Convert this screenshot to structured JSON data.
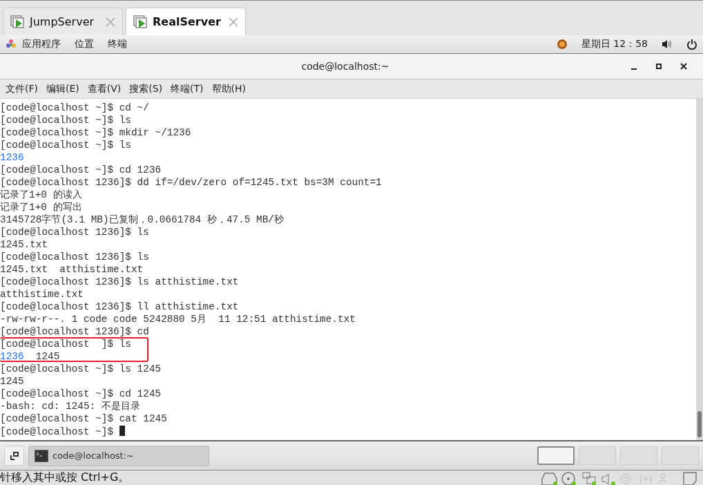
{
  "tabs": [
    {
      "label": "JumpServer",
      "selected": false
    },
    {
      "label": "RealServer",
      "selected": true
    }
  ],
  "top_panel": {
    "menus": [
      "应用程序",
      "位置",
      "终端"
    ],
    "clock": "星期日 12：58"
  },
  "window": {
    "title": "code@localhost:~"
  },
  "menu_bar": [
    "文件(F)",
    "编辑(E)",
    "查看(V)",
    "搜索(S)",
    "终端(T)",
    "帮助(H)"
  ],
  "terminal": {
    "lines": [
      {
        "parts": [
          {
            "text": "[code@localhost ~]$ cd ~/",
            "kind": "plain"
          }
        ],
        "highlighted": false,
        "cursor": false
      },
      {
        "parts": [
          {
            "text": "[code@localhost ~]$ ls",
            "kind": "plain"
          }
        ],
        "highlighted": false,
        "cursor": false
      },
      {
        "parts": [
          {
            "text": "[code@localhost ~]$ mkdir ~/1236",
            "kind": "plain"
          }
        ],
        "highlighted": false,
        "cursor": false
      },
      {
        "parts": [
          {
            "text": "[code@localhost ~]$ ls",
            "kind": "plain"
          }
        ],
        "highlighted": false,
        "cursor": false
      },
      {
        "parts": [
          {
            "text": "1236",
            "kind": "dir"
          }
        ],
        "highlighted": false,
        "cursor": false
      },
      {
        "parts": [
          {
            "text": "[code@localhost ~]$ cd 1236",
            "kind": "plain"
          }
        ],
        "highlighted": false,
        "cursor": false
      },
      {
        "parts": [
          {
            "text": "[code@localhost 1236]$ dd if=/dev/zero of=1245.txt bs=3M count=1",
            "kind": "plain"
          }
        ],
        "highlighted": false,
        "cursor": false
      },
      {
        "parts": [
          {
            "text": "记录了1+0 的读入",
            "kind": "plain"
          }
        ],
        "highlighted": false,
        "cursor": false
      },
      {
        "parts": [
          {
            "text": "记录了1+0 的写出",
            "kind": "plain"
          }
        ],
        "highlighted": false,
        "cursor": false
      },
      {
        "parts": [
          {
            "text": "3145728字节(3.1 MB)已复制，0.0661784 秒，47.5 MB/秒",
            "kind": "plain"
          }
        ],
        "highlighted": false,
        "cursor": false
      },
      {
        "parts": [
          {
            "text": "[code@localhost 1236]$ ls",
            "kind": "plain"
          }
        ],
        "highlighted": false,
        "cursor": false
      },
      {
        "parts": [
          {
            "text": "1245.txt",
            "kind": "plain"
          }
        ],
        "highlighted": false,
        "cursor": false
      },
      {
        "parts": [
          {
            "text": "[code@localhost 1236]$ ls",
            "kind": "plain"
          }
        ],
        "highlighted": false,
        "cursor": false
      },
      {
        "parts": [
          {
            "text": "1245.txt  atthistime.txt",
            "kind": "plain"
          }
        ],
        "highlighted": false,
        "cursor": false
      },
      {
        "parts": [
          {
            "text": "[code@localhost 1236]$ ls atthistime.txt",
            "kind": "plain"
          }
        ],
        "highlighted": false,
        "cursor": false
      },
      {
        "parts": [
          {
            "text": "atthistime.txt",
            "kind": "plain"
          }
        ],
        "highlighted": false,
        "cursor": false
      },
      {
        "parts": [
          {
            "text": "[code@localhost 1236]$ ll atthistime.txt",
            "kind": "plain"
          }
        ],
        "highlighted": false,
        "cursor": false
      },
      {
        "parts": [
          {
            "text": "-rw-rw-r--. 1 code code 5242880 5月  11 12:51 atthistime.txt",
            "kind": "plain"
          }
        ],
        "highlighted": false,
        "cursor": false
      },
      {
        "parts": [
          {
            "text": "[code@localhost 1236]$ cd",
            "kind": "plain"
          }
        ],
        "highlighted": false,
        "cursor": false
      },
      {
        "parts": [
          {
            "text": "[code@localhost  ]$ ls",
            "kind": "plain"
          }
        ],
        "highlighted": true,
        "cursor": false
      },
      {
        "parts": [
          {
            "text": "1236",
            "kind": "dir"
          },
          {
            "text": "  1245",
            "kind": "plain"
          }
        ],
        "highlighted": true,
        "cursor": false
      },
      {
        "parts": [
          {
            "text": "[code@localhost ~]$ ls 1245",
            "kind": "plain"
          }
        ],
        "highlighted": false,
        "cursor": false
      },
      {
        "parts": [
          {
            "text": "1245",
            "kind": "plain"
          }
        ],
        "highlighted": false,
        "cursor": false
      },
      {
        "parts": [
          {
            "text": "[code@localhost ~]$ cd 1245",
            "kind": "plain"
          }
        ],
        "highlighted": false,
        "cursor": false
      },
      {
        "parts": [
          {
            "text": "-bash: cd: 1245: 不是目录",
            "kind": "plain"
          }
        ],
        "highlighted": false,
        "cursor": false
      },
      {
        "parts": [
          {
            "text": "[code@localhost ~]$ cat 1245",
            "kind": "plain"
          }
        ],
        "highlighted": false,
        "cursor": false
      },
      {
        "parts": [
          {
            "text": "[code@localhost ~]$ ",
            "kind": "plain"
          }
        ],
        "highlighted": false,
        "cursor": true
      }
    ]
  },
  "taskbar": {
    "window_button": "code@localhost:~",
    "workspaces": [
      {
        "selected": true
      },
      {
        "selected": false
      },
      {
        "selected": false
      },
      {
        "selected": false
      }
    ]
  },
  "vm_status": {
    "hint": "针移入其中或按 Ctrl+G。"
  }
}
